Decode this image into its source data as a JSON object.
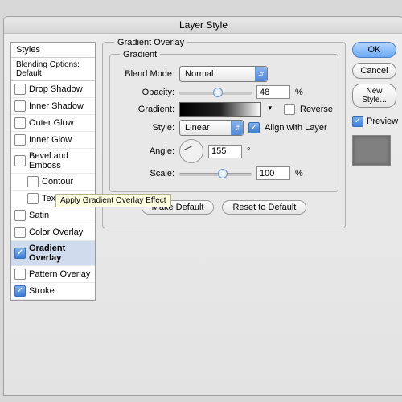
{
  "title": "Layer Style",
  "styles": {
    "header": "Styles",
    "subheader": "Blending Options: Default",
    "items": [
      {
        "label": "Drop Shadow",
        "checked": false
      },
      {
        "label": "Inner Shadow",
        "checked": false
      },
      {
        "label": "Outer Glow",
        "checked": false
      },
      {
        "label": "Inner Glow",
        "checked": false
      },
      {
        "label": "Bevel and Emboss",
        "checked": false
      },
      {
        "label": "Contour",
        "checked": false,
        "indent": true
      },
      {
        "label": "Texture",
        "checked": false,
        "indent": true
      },
      {
        "label": "Satin",
        "checked": false
      },
      {
        "label": "Color Overlay",
        "checked": false
      },
      {
        "label": "Gradient Overlay",
        "checked": true,
        "selected": true
      },
      {
        "label": "Pattern Overlay",
        "checked": false
      },
      {
        "label": "Stroke",
        "checked": true
      }
    ]
  },
  "group": {
    "title": "Gradient Overlay",
    "inner_title": "Gradient",
    "blend_mode_label": "Blend Mode:",
    "blend_mode_value": "Normal",
    "opacity_label": "Opacity:",
    "opacity_value": "48",
    "gradient_label": "Gradient:",
    "reverse_label": "Reverse",
    "style_label": "Style:",
    "style_value": "Linear",
    "align_label": "Align with Layer",
    "angle_label": "Angle:",
    "angle_value": "155",
    "angle_deg": "°",
    "scale_label": "Scale:",
    "scale_value": "100",
    "percent": "%",
    "make_default": "Make Default",
    "reset_default": "Reset to Default"
  },
  "buttons": {
    "ok": "OK",
    "cancel": "Cancel",
    "new_style": "New Style...",
    "preview": "Preview"
  },
  "tooltip": "Apply Gradient Overlay Effect"
}
